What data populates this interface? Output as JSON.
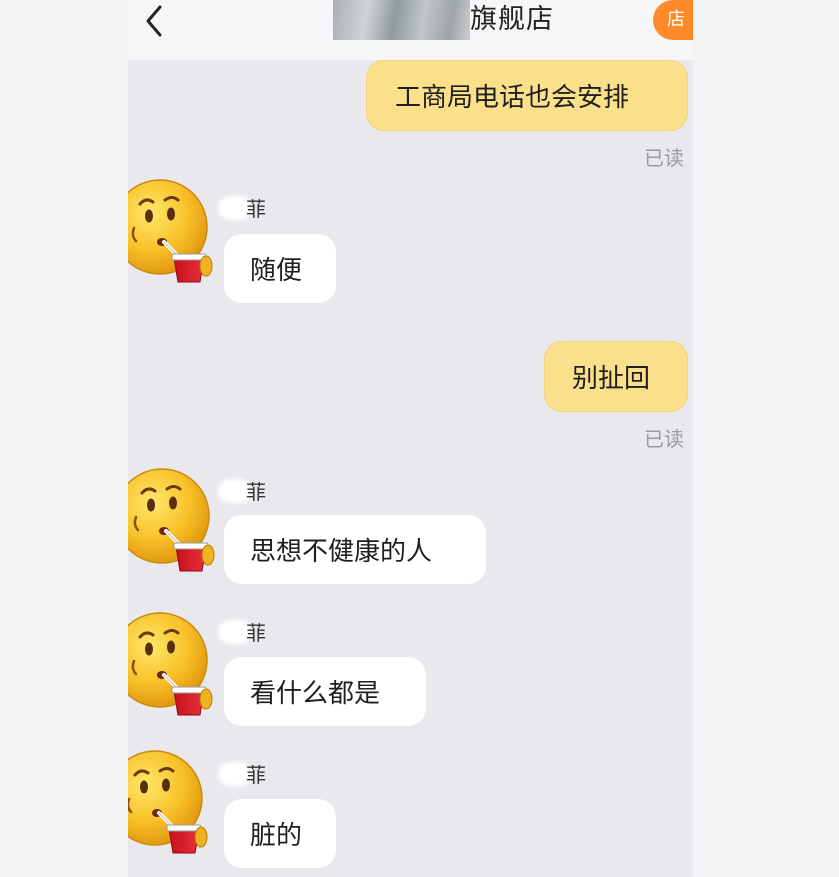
{
  "header": {
    "title": "旗舰店",
    "store_badge": "店"
  },
  "messages": [
    {
      "direction": "out",
      "text": "工商局电话也会安排",
      "status": "已读"
    },
    {
      "direction": "in",
      "sender": "菲",
      "text": "随便"
    },
    {
      "direction": "out",
      "text": "别扯回",
      "status": "已读"
    },
    {
      "direction": "in",
      "sender": "菲",
      "text": "思想不健康的人"
    },
    {
      "direction": "in",
      "sender": "菲",
      "text": "看什么都是"
    },
    {
      "direction": "in",
      "sender": "菲",
      "text": "脏的"
    }
  ],
  "colors": {
    "accent": "#ff8a2a",
    "out_bubble": "#fbe08c",
    "in_bubble": "#ffffff",
    "chat_bg": "#e9e8ec"
  },
  "avatar_icon": "drinking-emoji-icon"
}
